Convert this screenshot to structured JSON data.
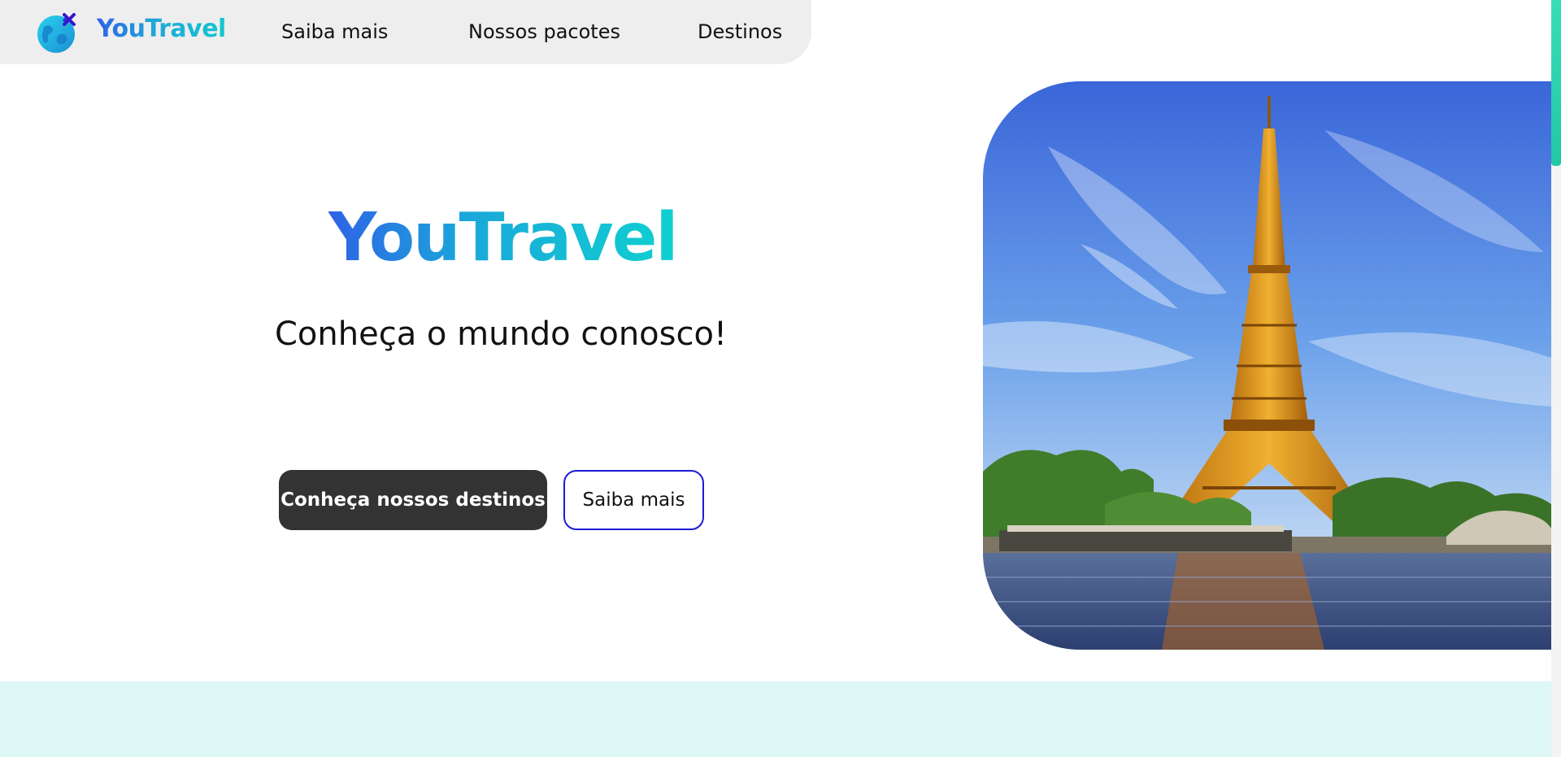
{
  "nav": {
    "brand": "YouTravel",
    "links": [
      "Saiba mais",
      "Nossos pacotes",
      "Destinos"
    ],
    "logo_icon": "globe-airplane-icon"
  },
  "hero": {
    "title": "YouTravel",
    "subtitle": "Conheça o mundo conosco!",
    "primary_button": "Conheça nossos destinos",
    "secondary_button": "Saiba mais",
    "image": "eiffel-tower-photo"
  },
  "colors": {
    "brand_blue": "#2f62e6",
    "brand_cyan": "#12c7cf",
    "primary_button_bg": "#333333",
    "secondary_button_border": "#1b1bd6",
    "nav_bg": "#eeeeee",
    "band_bg": "#def7f7",
    "scroll_thumb": "#39dcb8"
  }
}
